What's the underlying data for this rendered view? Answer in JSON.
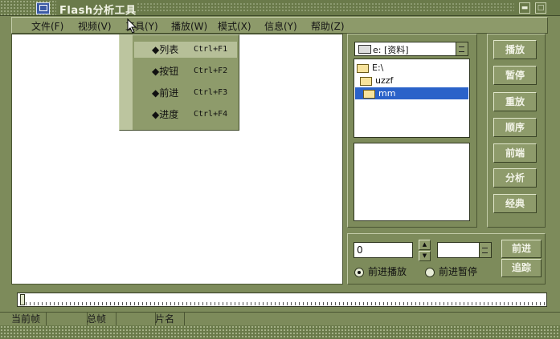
{
  "window": {
    "title": "Flash分析工具"
  },
  "menu": [
    {
      "label": "文件(F)"
    },
    {
      "label": "视频(V)"
    },
    {
      "label": "工具(Y)"
    },
    {
      "label": "播放(W)"
    },
    {
      "label": "模式(X)"
    },
    {
      "label": "信息(Y)"
    },
    {
      "label": "帮助(Z)"
    }
  ],
  "dropdown": [
    {
      "label": "◆列表",
      "shortcut": "Ctrl+F1",
      "active": true
    },
    {
      "label": "◆按钮",
      "shortcut": "Ctrl+F2"
    },
    {
      "label": "◆前进",
      "shortcut": "Ctrl+F3"
    },
    {
      "label": "◆进度",
      "shortcut": "Ctrl+F4"
    }
  ],
  "drive_combo": {
    "value": "e: [资料]"
  },
  "directories": [
    {
      "label": "E:\\"
    },
    {
      "label": "uzzf"
    },
    {
      "label": "mm",
      "selected": true
    }
  ],
  "side_buttons": [
    "播放",
    "暂停",
    "重放",
    "顺序",
    "前端",
    "分析",
    "经典"
  ],
  "controls": {
    "frame_value": "0",
    "combo_value": "",
    "radio_forward_play": "前进播放",
    "radio_forward_pause": "前进暂停",
    "btn_forward": "前进",
    "btn_trace": "追踪",
    "spin_up": "▲",
    "spin_down": "▼"
  },
  "status": {
    "current_frame": "当前帧",
    "total_frames": "总帧",
    "clip_name": "片名"
  },
  "colors": {
    "frame_bg": "#7d8b5b",
    "selected": "#2a62c9"
  }
}
